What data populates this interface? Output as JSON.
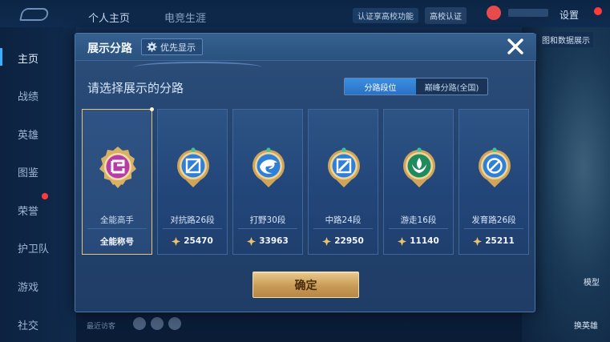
{
  "topbar": {
    "tabs": [
      "个人主页",
      "电竞生涯"
    ],
    "share_text": "认证享高校功能",
    "campus_label": "高校认证",
    "settings_label": "设置"
  },
  "sidebar": {
    "items": [
      "主页",
      "战绩",
      "英雄",
      "图鉴",
      "荣誉",
      "护卫队",
      "游戏",
      "社交"
    ]
  },
  "background": {
    "top_right_label": "图和数据展示",
    "model_label": "模型",
    "hero_label": "换英雄",
    "visitors_label": "最近访客"
  },
  "modal": {
    "title": "展示分路",
    "priority_button": "优先显示",
    "subtitle": "请选择展示的分路",
    "segment": {
      "options": [
        "分路段位",
        "巅峰分路(全国)"
      ],
      "active": "分路段位"
    },
    "cards": [
      {
        "name": "全能高手",
        "footer": "全能称号",
        "selected": true,
        "emblem": "all-round-emblem-icon",
        "color": "#b63ca8"
      },
      {
        "name": "对抗路26段",
        "score": "25470",
        "selected": false,
        "emblem": "clash-lane-emblem-icon",
        "color": "#2d7fd8"
      },
      {
        "name": "打野30段",
        "score": "33963",
        "selected": false,
        "emblem": "jungle-emblem-icon",
        "color": "#2d7fd8"
      },
      {
        "name": "中路24段",
        "score": "22950",
        "selected": false,
        "emblem": "mid-lane-emblem-icon",
        "color": "#2d7fd8"
      },
      {
        "name": "游走16段",
        "score": "11140",
        "selected": false,
        "emblem": "roam-emblem-icon",
        "color": "#1f8a5d"
      },
      {
        "name": "发育路26段",
        "score": "25211",
        "selected": false,
        "emblem": "farm-lane-emblem-icon",
        "color": "#2d7fd8"
      }
    ],
    "confirm_label": "确定"
  }
}
